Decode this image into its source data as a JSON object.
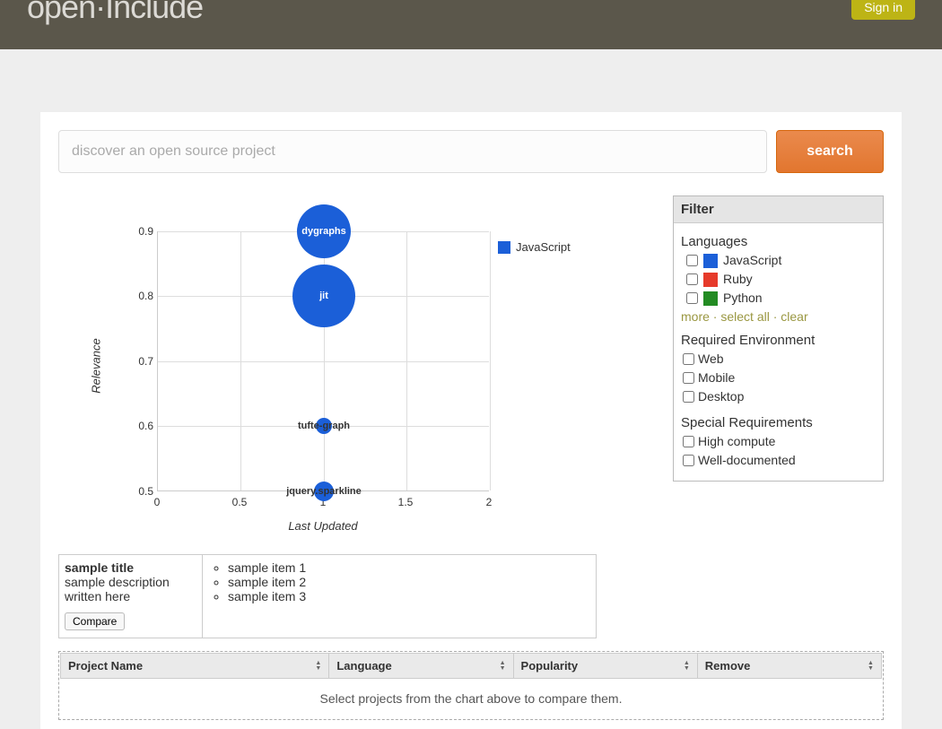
{
  "brand": "open·Include",
  "signin_label": "Sign in",
  "search": {
    "placeholder": "discover an open source project",
    "button": "search"
  },
  "chart_data": {
    "type": "bubble",
    "xlabel": "Last Updated",
    "ylabel": "Relevance",
    "xlim": [
      0.0,
      2.0
    ],
    "ylim": [
      0.5,
      0.9
    ],
    "xticks": [
      0.0,
      0.5,
      1.0,
      1.5,
      2.0
    ],
    "yticks": [
      0.5,
      0.6,
      0.7,
      0.8,
      0.9
    ],
    "legend": [
      "JavaScript"
    ],
    "points": [
      {
        "label": "dygraphs",
        "x": 1.0,
        "y": 0.9,
        "size": 60,
        "color": "#1b5fd8"
      },
      {
        "label": "jit",
        "x": 1.0,
        "y": 0.8,
        "size": 70,
        "color": "#1b5fd8"
      },
      {
        "label": "tufte-graph",
        "x": 1.0,
        "y": 0.6,
        "size": 18,
        "color": "#1b5fd8"
      },
      {
        "label": "jquery.sparkline",
        "x": 1.0,
        "y": 0.5,
        "size": 22,
        "color": "#1b5fd8"
      }
    ]
  },
  "filter": {
    "header": "Filter",
    "languages_title": "Languages",
    "languages": [
      {
        "label": "JavaScript",
        "color": "#1b5fd8"
      },
      {
        "label": "Ruby",
        "color": "#e63a2a"
      },
      {
        "label": "Python",
        "color": "#228b22"
      }
    ],
    "links": {
      "more": "more",
      "select_all": "select all",
      "clear": "clear"
    },
    "env_title": "Required Environment",
    "envs": [
      "Web",
      "Mobile",
      "Desktop"
    ],
    "special_title": "Special Requirements",
    "specials": [
      "High compute",
      "Well-documented"
    ]
  },
  "sample": {
    "title": "sample title",
    "desc": "sample description written here",
    "compare": "Compare",
    "items": [
      "sample item 1",
      "sample item 2",
      "sample item 3"
    ]
  },
  "table": {
    "columns": [
      "Project Name",
      "Language",
      "Popularity",
      "Remove"
    ],
    "empty_msg": "Select projects from the chart above to compare them."
  }
}
